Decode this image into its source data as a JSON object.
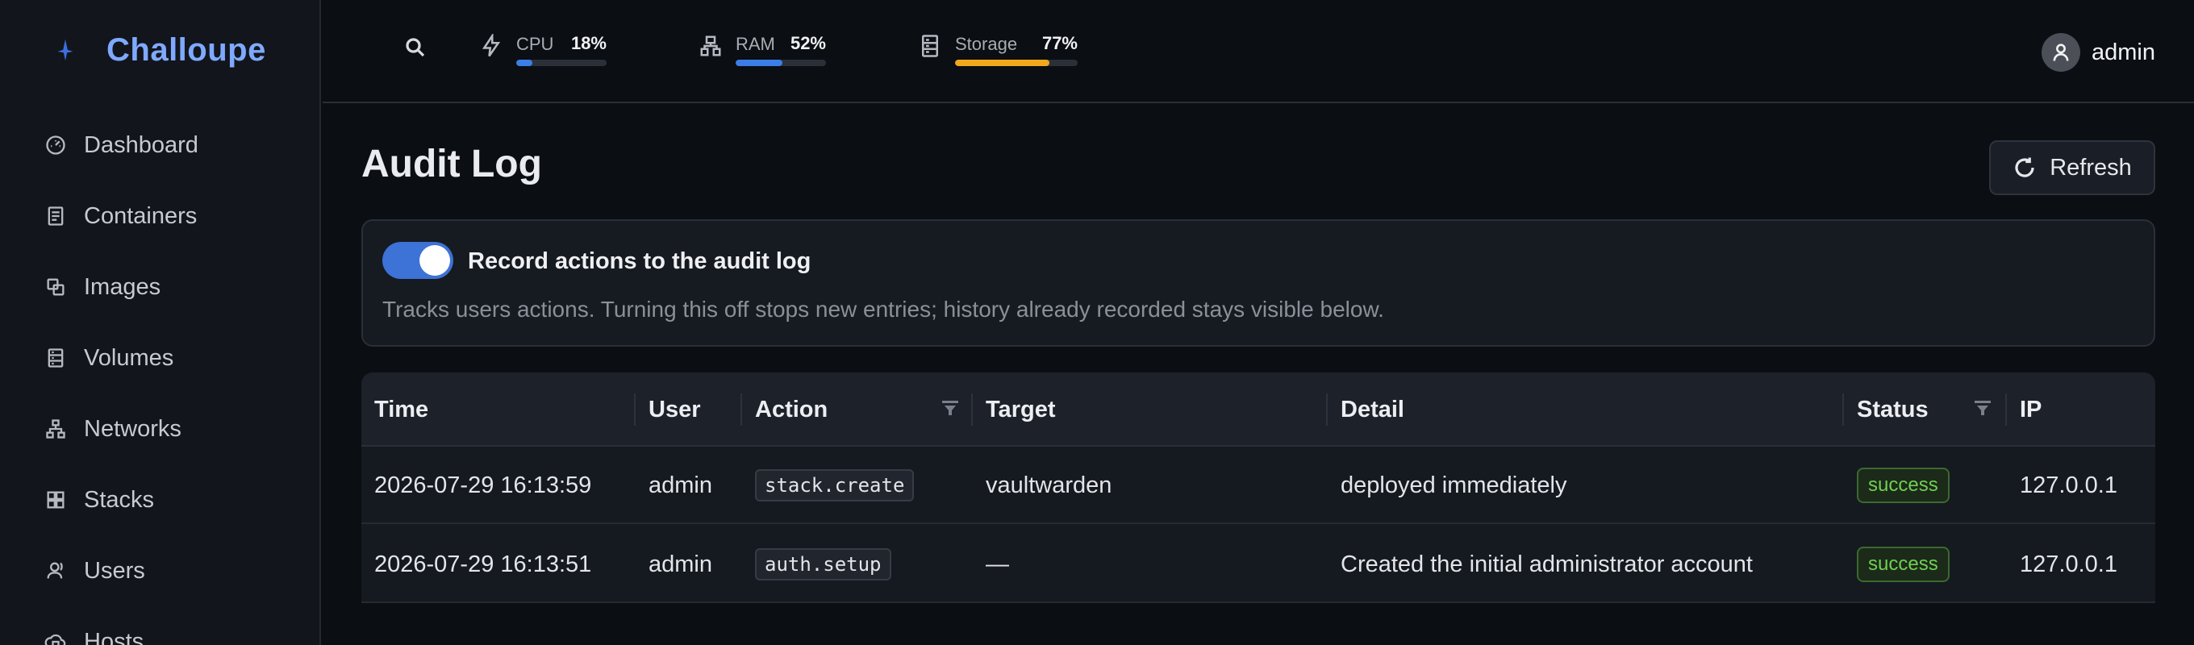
{
  "app": {
    "name": "Challoupe",
    "accent": "#7fa9ff"
  },
  "sidebar": {
    "items": [
      {
        "label": "Dashboard",
        "icon": "dashboard-icon"
      },
      {
        "label": "Containers",
        "icon": "container-icon"
      },
      {
        "label": "Images",
        "icon": "images-icon"
      },
      {
        "label": "Volumes",
        "icon": "volume-icon"
      },
      {
        "label": "Networks",
        "icon": "network-icon"
      },
      {
        "label": "Stacks",
        "icon": "stacks-icon"
      },
      {
        "label": "Users",
        "icon": "users-icon"
      },
      {
        "label": "Hosts",
        "icon": "hosts-icon"
      }
    ]
  },
  "topbar": {
    "metrics": [
      {
        "label": "CPU",
        "value": "18%",
        "fraction": 0.18,
        "color": "#3b7ee8",
        "icon": "bolt-icon"
      },
      {
        "label": "RAM",
        "value": "52%",
        "fraction": 0.52,
        "color": "#3b7ee8",
        "icon": "network-icon"
      },
      {
        "label": "Storage",
        "value": "77%",
        "fraction": 0.77,
        "color": "#f0a81c",
        "icon": "storage-icon"
      }
    ],
    "user": {
      "name": "admin"
    }
  },
  "page": {
    "title": "Audit Log",
    "refresh_label": "Refresh"
  },
  "audit": {
    "enabled": true,
    "toggle_color": "#3d72d6",
    "title": "Record actions to the audit log",
    "description": "Tracks users actions. Turning this off stops new entries; history already recorded stays visible below."
  },
  "table": {
    "columns": [
      "Time",
      "User",
      "Action",
      "Target",
      "Detail",
      "Status",
      "IP"
    ],
    "rows": [
      {
        "time": "2026-07-29 16:13:59",
        "user": "admin",
        "action": "stack.create",
        "target": "vaultwarden",
        "detail": "deployed immediately",
        "status": "success",
        "ip": "127.0.0.1"
      },
      {
        "time": "2026-07-29 16:13:51",
        "user": "admin",
        "action": "auth.setup",
        "target": "—",
        "detail": "Created the initial administrator account",
        "status": "success",
        "ip": "127.0.0.1"
      }
    ]
  }
}
